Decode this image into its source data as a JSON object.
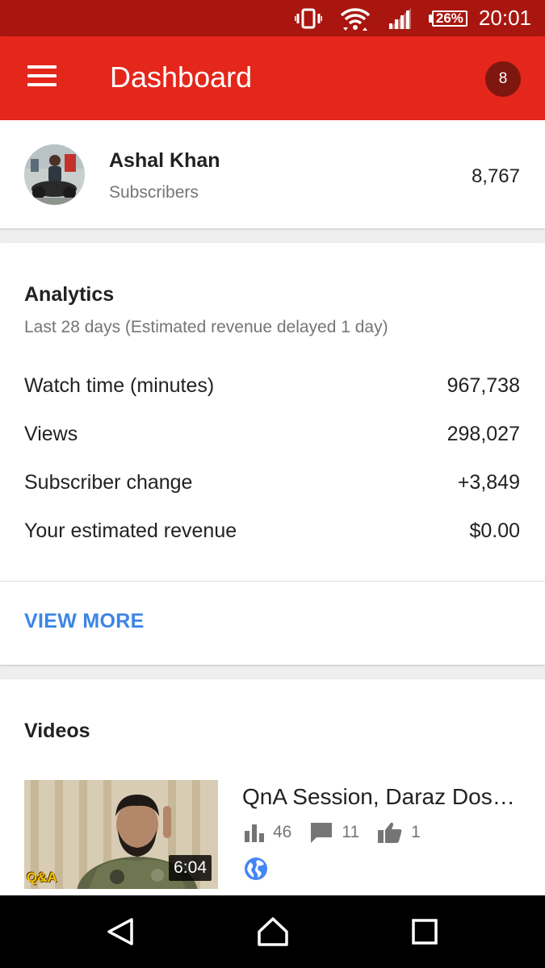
{
  "status_bar": {
    "battery": "26%",
    "time": "20:01",
    "icons": [
      "vibrate-icon",
      "wifi-icon",
      "cell-signal-icon",
      "battery-icon"
    ]
  },
  "app_bar": {
    "title": "Dashboard",
    "notification_count": "8",
    "color": "#e4261b"
  },
  "channel": {
    "name": "Ashal Khan",
    "subscribers_label": "Subscribers",
    "subscribers_count": "8,767"
  },
  "analytics": {
    "title": "Analytics",
    "subtitle": "Last 28 days (Estimated revenue delayed 1 day)",
    "metrics": [
      {
        "label": "Watch time (minutes)",
        "value": "967,738"
      },
      {
        "label": "Views",
        "value": "298,027"
      },
      {
        "label": "Subscriber change",
        "value": "+3,849"
      },
      {
        "label": "Your estimated revenue",
        "value": "$0.00"
      }
    ],
    "view_more": "VIEW MORE",
    "link_color": "#3d84e6"
  },
  "videos": {
    "title": "Videos",
    "items": [
      {
        "title": "QnA Session, Daraz Dos…",
        "duration": "6:04",
        "thumb_label": "Q&A",
        "views": "46",
        "comments": "11",
        "likes": "1",
        "visibility_icon": "globe-icon"
      }
    ]
  },
  "nav_bar": {
    "buttons": [
      "back-icon",
      "home-icon",
      "recents-icon"
    ]
  }
}
